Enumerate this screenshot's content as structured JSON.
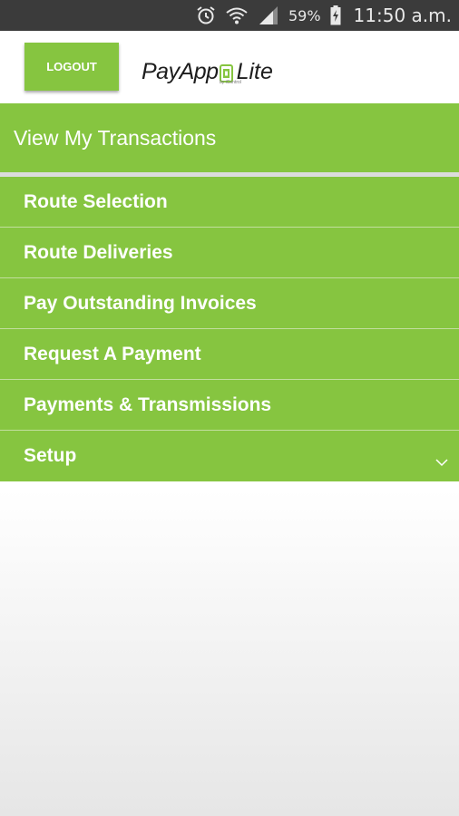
{
  "status_bar": {
    "battery_percent": "59%",
    "time": "11:50 a.m.",
    "icons": [
      "alarm-icon",
      "wifi-icon",
      "signal-icon",
      "battery-charging-icon"
    ]
  },
  "header": {
    "logout_label": "LOGOUT",
    "logo": {
      "main": "PayApp",
      "suffix": "Lite",
      "sub": "by iControl"
    }
  },
  "title": "View My Transactions",
  "menu": {
    "items": [
      {
        "label": "Route Selection"
      },
      {
        "label": "Route Deliveries"
      },
      {
        "label": "Pay Outstanding Invoices"
      },
      {
        "label": "Request A Payment"
      },
      {
        "label": "Payments & Transmissions"
      },
      {
        "label": "Setup",
        "icon": "chevron-down-icon"
      }
    ]
  },
  "colors": {
    "accent": "#86c540",
    "status_bar": "#3b3b3b",
    "logo_accent": "#86c540",
    "logo_highlight": "#f5c518"
  }
}
